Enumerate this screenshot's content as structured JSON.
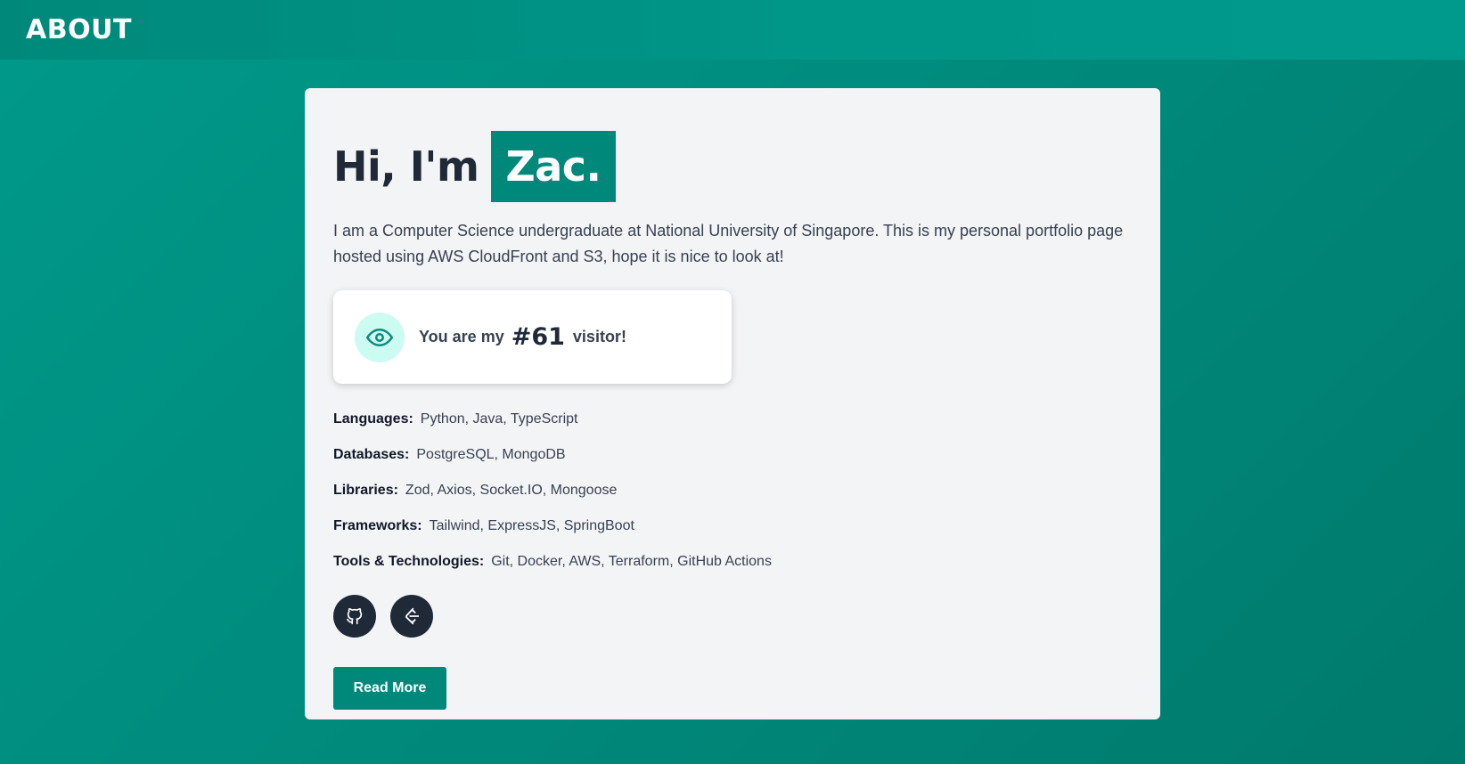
{
  "header": {
    "title": "ABOUT"
  },
  "hero": {
    "greeting": "Hi, I'm",
    "name": "Zac."
  },
  "intro": "I am a Computer Science undergraduate at National University of Singapore. This is my personal portfolio page hosted using AWS CloudFront and S3, hope it is nice to look at!",
  "visitor": {
    "prefix": "You are my",
    "count": "#61",
    "suffix": "visitor!",
    "icon": "eye-icon"
  },
  "skills": [
    {
      "label": "Languages:",
      "value": "Python, Java, TypeScript"
    },
    {
      "label": "Databases:",
      "value": "PostgreSQL, MongoDB"
    },
    {
      "label": "Libraries:",
      "value": "Zod, Axios, Socket.IO, Mongoose"
    },
    {
      "label": "Frameworks:",
      "value": "Tailwind, ExpressJS, SpringBoot"
    },
    {
      "label": "Tools & Technologies:",
      "value": "Git, Docker, AWS, Terraform, GitHub Actions"
    }
  ],
  "socials": [
    {
      "icon": "github-icon"
    },
    {
      "icon": "leetcode-icon"
    }
  ],
  "read_more_label": "Read More",
  "colors": {
    "accent": "#00897b",
    "background": "#009688",
    "card": "#f3f4f6",
    "dark": "#1f2937",
    "eye_bg": "#ccfbf1"
  }
}
